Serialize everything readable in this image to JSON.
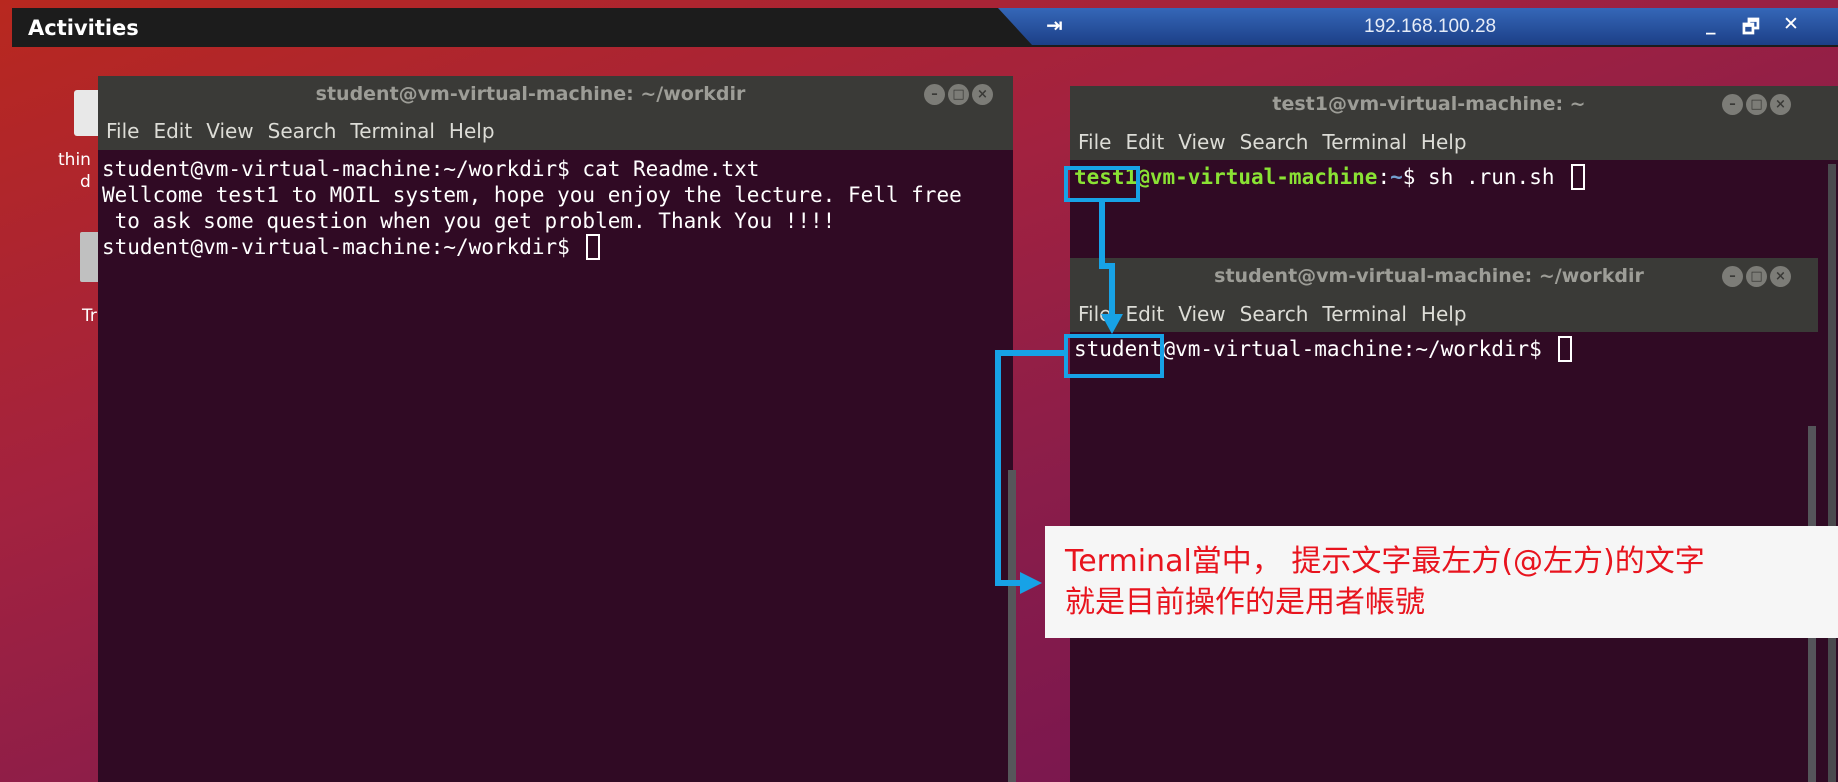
{
  "topbar": {
    "activities_label": "Activities"
  },
  "rdp": {
    "pin_icon": "pin-icon",
    "host_label": "192.168.100.28",
    "minimize_icon": "_",
    "restore_icon": "🗗",
    "close_icon": "✕"
  },
  "desktop": {
    "items": [
      {
        "label": "thin"
      },
      {
        "label": "d"
      },
      {
        "label": "Tr"
      }
    ]
  },
  "terminal_left": {
    "title": "student@vm-virtual-machine: ~/workdir",
    "menu": [
      "File",
      "Edit",
      "View",
      "Search",
      "Terminal",
      "Help"
    ],
    "lines": [
      "student@vm-virtual-machine:~/workdir$ cat Readme.txt",
      "Wellcome test1 to MOIL system, hope you enjoy the lecture. Fell free",
      " to ask some question when you get problem. Thank You !!!!",
      "student@vm-virtual-machine:~/workdir$ "
    ]
  },
  "terminal_test1": {
    "title": "test1@vm-virtual-machine: ~",
    "menu": [
      "File",
      "Edit",
      "View",
      "Search",
      "Terminal",
      "Help"
    ],
    "prompt_user": "test1@vm-virtual-machine",
    "prompt_sep": ":",
    "prompt_path": "~",
    "prompt_symbol": "$",
    "command": " sh .run.sh "
  },
  "terminal_student": {
    "title": "student@vm-virtual-machine: ~/workdir",
    "menu": [
      "File",
      "Edit",
      "View",
      "Search",
      "Terminal",
      "Help"
    ],
    "prompt": "student@vm-virtual-machine:~/workdir$ "
  },
  "annotation": {
    "highlight_color": "#17a2e6",
    "line1": "Terminal當中， 提示文字最左方(@左方)的文字",
    "line2": "就是目前操作的是用者帳號",
    "text_color": "#e8141e"
  },
  "colors": {
    "terminal_bg": "#300a24",
    "prompt_green": "#8ae234",
    "prompt_blue": "#729fcf"
  }
}
